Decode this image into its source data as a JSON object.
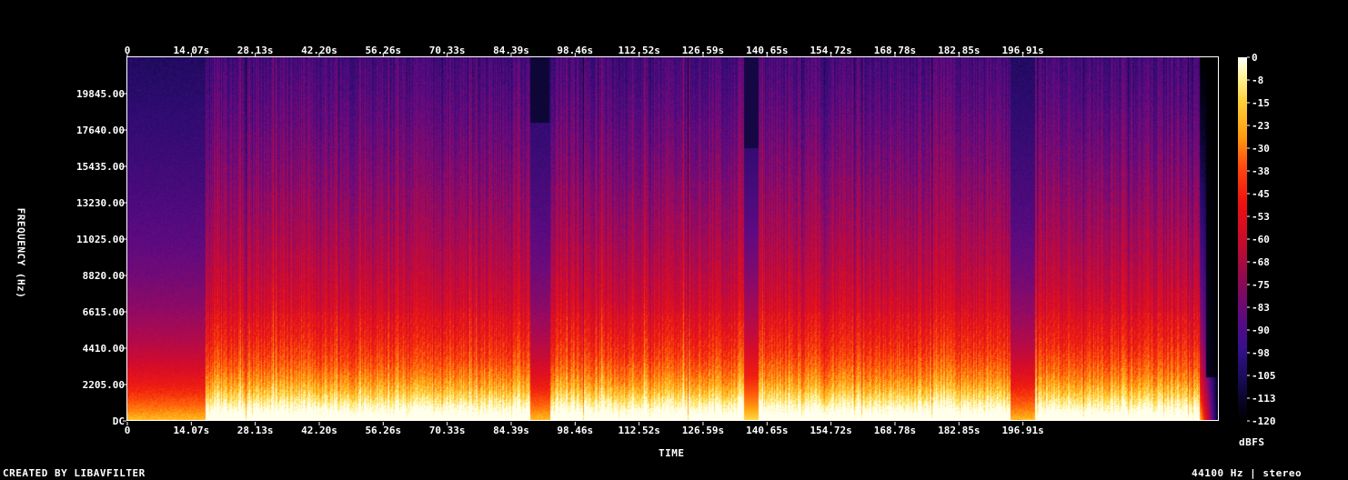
{
  "chart_data": {
    "type": "heatmap",
    "title": "",
    "xlabel": "TIME",
    "ylabel": "FREQUENCY (Hz)",
    "colorbar_label": "dBFS",
    "x_ticks": [
      "0",
      "14.07s",
      "28.13s",
      "42.20s",
      "56.26s",
      "70.33s",
      "84.39s",
      "98.46s",
      "112.52s",
      "126.59s",
      "140.65s",
      "154.72s",
      "168.78s",
      "182.85s",
      "196.91s"
    ],
    "y_ticks": [
      "DC",
      "2205.00",
      "4410.00",
      "6615.00",
      "8820.00",
      "11025.00",
      "13230.00",
      "15435.00",
      "17640.00",
      "19845.00"
    ],
    "colorbar_ticks": [
      "0",
      "-8",
      "-15",
      "-23",
      "-30",
      "-38",
      "-45",
      "-53",
      "-60",
      "-68",
      "-75",
      "-83",
      "-90",
      "-98",
      "-105",
      "-113",
      "-120"
    ],
    "xlim": [
      0,
      225
    ],
    "ylim": [
      0,
      22050
    ],
    "zlim": [
      -120,
      0
    ],
    "quiet_segments_s": [
      [
        0,
        16
      ],
      [
        83,
        87
      ],
      [
        127,
        130
      ],
      [
        182,
        187
      ]
    ],
    "end_fade_s": 221
  },
  "footer": {
    "credit": "CREATED BY LIBAVFILTER",
    "format": "44100 Hz | stereo"
  },
  "colors": {
    "background": "#000000",
    "text": "#ffffff"
  }
}
